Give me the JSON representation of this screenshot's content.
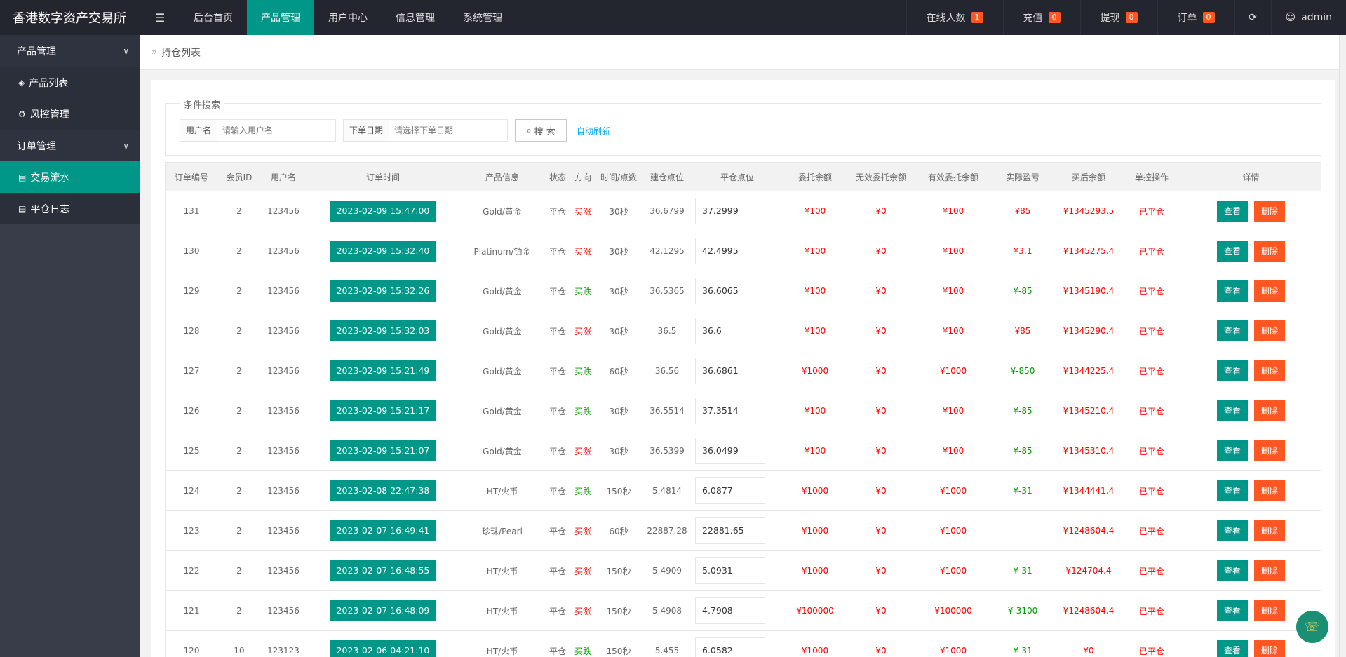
{
  "app": {
    "title": "香港数字资产交易所"
  },
  "topnav": {
    "items": [
      {
        "label": "后台首页"
      },
      {
        "label": "产品管理"
      },
      {
        "label": "用户中心"
      },
      {
        "label": "信息管理"
      },
      {
        "label": "系统管理"
      }
    ],
    "online": {
      "label": "在线人数",
      "count": "1"
    },
    "recharge": {
      "label": "充值",
      "count": "0"
    },
    "withdraw": {
      "label": "提现",
      "count": "0"
    },
    "orders": {
      "label": "订单",
      "count": "0"
    },
    "user": "admin"
  },
  "sidebar": {
    "group1": "产品管理",
    "item1": "产品列表",
    "item2": "风控管理",
    "group2": "订单管理",
    "item3": "交易流水",
    "item4": "平仓日志"
  },
  "breadcrumb": "持仓列表",
  "search": {
    "legend": "条件搜索",
    "username_label": "用户名",
    "username_placeholder": "请输入用户名",
    "date_label": "下单日期",
    "date_placeholder": "请选择下单日期",
    "button": "搜 索",
    "auto_refresh": "自动刷新"
  },
  "table": {
    "headers": [
      "订单编号",
      "会员ID",
      "用户名",
      "订单时间",
      "产品信息",
      "状态",
      "方向",
      "时间/点数",
      "建仓点位",
      "平仓点位",
      "委托余额",
      "无效委托余额",
      "有效委托余额",
      "实际盈亏",
      "买后余额",
      "单控操作",
      "详情"
    ],
    "view_label": "查看",
    "delete_label": "删除",
    "rows": [
      {
        "id": "131",
        "member": "2",
        "user": "123456",
        "time": "2023-02-09 15:47:00",
        "product": "Gold/黄金",
        "status": "平仓",
        "dir": "买涨",
        "dirType": "rise",
        "period": "30秒",
        "open": "36.6799",
        "close": "37.2999",
        "amount": "¥100",
        "invalid": "¥0",
        "valid": "¥100",
        "pnl": "¥85",
        "pnlType": "red",
        "balance": "¥1345293.5",
        "ctrl": "已平仓"
      },
      {
        "id": "130",
        "member": "2",
        "user": "123456",
        "time": "2023-02-09 15:32:40",
        "product": "Platinum/铂金",
        "status": "平仓",
        "dir": "买涨",
        "dirType": "rise",
        "period": "30秒",
        "open": "42.1295",
        "close": "42.4995",
        "amount": "¥100",
        "invalid": "¥0",
        "valid": "¥100",
        "pnl": "¥3.1",
        "pnlType": "red",
        "balance": "¥1345275.4",
        "ctrl": "已平仓"
      },
      {
        "id": "129",
        "member": "2",
        "user": "123456",
        "time": "2023-02-09 15:32:26",
        "product": "Gold/黄金",
        "status": "平仓",
        "dir": "买跌",
        "dirType": "fall",
        "period": "30秒",
        "open": "36.5365",
        "close": "36.6065",
        "amount": "¥100",
        "invalid": "¥0",
        "valid": "¥100",
        "pnl": "¥-85",
        "pnlType": "green",
        "balance": "¥1345190.4",
        "ctrl": "已平仓"
      },
      {
        "id": "128",
        "member": "2",
        "user": "123456",
        "time": "2023-02-09 15:32:03",
        "product": "Gold/黄金",
        "status": "平仓",
        "dir": "买涨",
        "dirType": "rise",
        "period": "30秒",
        "open": "36.5",
        "close": "36.6",
        "amount": "¥100",
        "invalid": "¥0",
        "valid": "¥100",
        "pnl": "¥85",
        "pnlType": "red",
        "balance": "¥1345290.4",
        "ctrl": "已平仓"
      },
      {
        "id": "127",
        "member": "2",
        "user": "123456",
        "time": "2023-02-09 15:21:49",
        "product": "Gold/黄金",
        "status": "平仓",
        "dir": "买跌",
        "dirType": "fall",
        "period": "60秒",
        "open": "36.56",
        "close": "36.6861",
        "amount": "¥1000",
        "invalid": "¥0",
        "valid": "¥1000",
        "pnl": "¥-850",
        "pnlType": "green",
        "balance": "¥1344225.4",
        "ctrl": "已平仓"
      },
      {
        "id": "126",
        "member": "2",
        "user": "123456",
        "time": "2023-02-09 15:21:17",
        "product": "Gold/黄金",
        "status": "平仓",
        "dir": "买跌",
        "dirType": "fall",
        "period": "30秒",
        "open": "36.5514",
        "close": "37.3514",
        "amount": "¥100",
        "invalid": "¥0",
        "valid": "¥100",
        "pnl": "¥-85",
        "pnlType": "green",
        "balance": "¥1345210.4",
        "ctrl": "已平仓"
      },
      {
        "id": "125",
        "member": "2",
        "user": "123456",
        "time": "2023-02-09 15:21:07",
        "product": "Gold/黄金",
        "status": "平仓",
        "dir": "买涨",
        "dirType": "rise",
        "period": "30秒",
        "open": "36.5399",
        "close": "36.0499",
        "amount": "¥100",
        "invalid": "¥0",
        "valid": "¥100",
        "pnl": "¥-85",
        "pnlType": "green",
        "balance": "¥1345310.4",
        "ctrl": "已平仓"
      },
      {
        "id": "124",
        "member": "2",
        "user": "123456",
        "time": "2023-02-08 22:47:38",
        "product": "HT/火币",
        "status": "平仓",
        "dir": "买跌",
        "dirType": "fall",
        "period": "150秒",
        "open": "5.4814",
        "close": "6.0877",
        "amount": "¥1000",
        "invalid": "¥0",
        "valid": "¥1000",
        "pnl": "¥-31",
        "pnlType": "green",
        "balance": "¥1344441.4",
        "ctrl": "已平仓"
      },
      {
        "id": "123",
        "member": "2",
        "user": "123456",
        "time": "2023-02-07 16:49:41",
        "product": "珍珠/Pearl",
        "status": "平仓",
        "dir": "买涨",
        "dirType": "rise",
        "period": "60秒",
        "open": "22887.28",
        "close": "22881.65",
        "amount": "¥1000",
        "invalid": "¥0",
        "valid": "¥1000",
        "pnl": "",
        "pnlType": "green",
        "balance": "¥1248604.4",
        "ctrl": "已平仓"
      },
      {
        "id": "122",
        "member": "2",
        "user": "123456",
        "time": "2023-02-07 16:48:55",
        "product": "HT/火币",
        "status": "平仓",
        "dir": "买涨",
        "dirType": "rise",
        "period": "150秒",
        "open": "5.4909",
        "close": "5.0931",
        "amount": "¥1000",
        "invalid": "¥0",
        "valid": "¥1000",
        "pnl": "¥-31",
        "pnlType": "green",
        "balance": "¥124704.4",
        "ctrl": "已平仓"
      },
      {
        "id": "121",
        "member": "2",
        "user": "123456",
        "time": "2023-02-07 16:48:09",
        "product": "HT/火币",
        "status": "平仓",
        "dir": "买涨",
        "dirType": "rise",
        "period": "150秒",
        "open": "5.4908",
        "close": "4.7908",
        "amount": "¥100000",
        "invalid": "¥0",
        "valid": "¥100000",
        "pnl": "¥-3100",
        "pnlType": "green",
        "balance": "¥1248604.4",
        "ctrl": "已平仓"
      },
      {
        "id": "120",
        "member": "10",
        "user": "123123",
        "time": "2023-02-06 04:21:10",
        "product": "HT/火币",
        "status": "平仓",
        "dir": "买跌",
        "dirType": "fall",
        "period": "150秒",
        "open": "5.455",
        "close": "6.0582",
        "amount": "¥1000",
        "invalid": "¥0",
        "valid": "¥1000",
        "pnl": "¥-31",
        "pnlType": "green",
        "balance": "¥0",
        "ctrl": "已平仓"
      }
    ]
  }
}
